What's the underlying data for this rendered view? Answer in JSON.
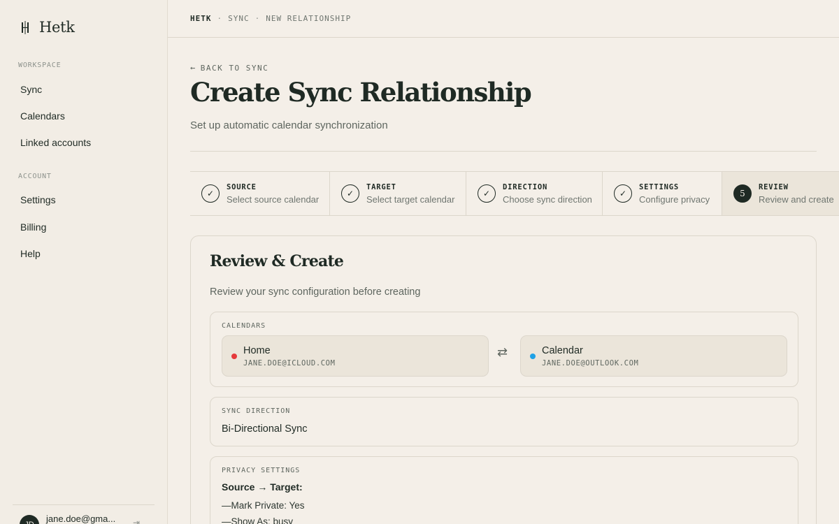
{
  "app": {
    "name": "Hetk"
  },
  "sidebar": {
    "workspace_label": "WORKSPACE",
    "workspace_items": [
      {
        "label": "Sync"
      },
      {
        "label": "Calendars"
      },
      {
        "label": "Linked accounts"
      }
    ],
    "account_label": "ACCOUNT",
    "account_items": [
      {
        "label": "Settings"
      },
      {
        "label": "Billing"
      },
      {
        "label": "Help"
      }
    ],
    "user": {
      "initials": "JD",
      "email": "jane.doe@gma..."
    }
  },
  "breadcrumb": [
    "HETK",
    "SYNC",
    "NEW RELATIONSHIP"
  ],
  "breadcrumb_separator": "·",
  "page": {
    "back_label": "BACK TO SYNC",
    "title": "Create Sync Relationship",
    "subtitle": "Set up automatic calendar synchronization"
  },
  "steps": [
    {
      "name": "SOURCE",
      "desc": "Select source calendar",
      "status": "done",
      "marker": "✓"
    },
    {
      "name": "TARGET",
      "desc": "Select target calendar",
      "status": "done",
      "marker": "✓"
    },
    {
      "name": "DIRECTION",
      "desc": "Choose sync direction",
      "status": "done",
      "marker": "✓"
    },
    {
      "name": "SETTINGS",
      "desc": "Configure privacy",
      "status": "done",
      "marker": "✓"
    },
    {
      "name": "REVIEW",
      "desc": "Review and create",
      "status": "active",
      "marker": "5"
    }
  ],
  "review": {
    "title": "Review & Create",
    "subtitle": "Review your sync configuration before creating",
    "calendars_label": "CALENDARS",
    "source": {
      "name": "Home",
      "account": "JANE.DOE@ICLOUD.COM",
      "color": "#e5393b"
    },
    "target": {
      "name": "Calendar",
      "account": "JANE.DOE@OUTLOOK.COM",
      "color": "#1ea1e6"
    },
    "direction_label": "SYNC DIRECTION",
    "direction_value": "Bi-Directional Sync",
    "privacy_label": "PRIVACY SETTINGS",
    "privacy_heading": "Source → Target:",
    "privacy_rows": [
      "—Mark Private: Yes",
      "—Show As: busy"
    ]
  },
  "colors": {
    "background": "#f4efe8",
    "ink": "#1f2a24",
    "muted": "#5e665f",
    "border": "#dcd6cb",
    "active_step_bg": "#ebe5da"
  }
}
